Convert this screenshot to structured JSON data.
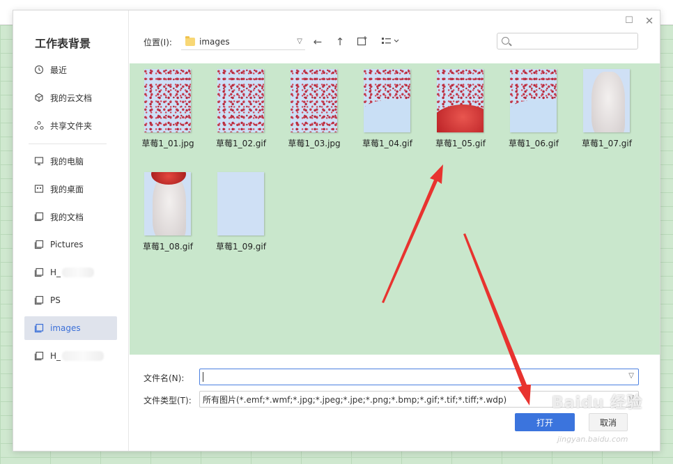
{
  "dialog": {
    "title": "工作表背景"
  },
  "sidebar": {
    "items": [
      {
        "label": "最近",
        "icon": "clock-icon"
      },
      {
        "label": "我的云文档",
        "icon": "cloud-box-icon"
      },
      {
        "label": "共享文件夹",
        "icon": "share-icon"
      },
      {
        "label": "我的电脑",
        "icon": "monitor-icon"
      },
      {
        "label": "我的桌面",
        "icon": "desktop-icon"
      },
      {
        "label": "我的文档",
        "icon": "document-folder-icon"
      },
      {
        "label": "Pictures",
        "icon": "folder-icon"
      },
      {
        "label": "H_",
        "icon": "folder-icon"
      },
      {
        "label": "PS",
        "icon": "folder-icon"
      },
      {
        "label": "images",
        "icon": "folder-icon",
        "active": true
      },
      {
        "label": "H_",
        "icon": "folder-icon"
      }
    ]
  },
  "toolbar": {
    "location_label": "位置(I):",
    "location_value": "images",
    "search_placeholder": ""
  },
  "files": [
    {
      "name": "草莓1_01.jpg"
    },
    {
      "name": "草莓1_02.gif"
    },
    {
      "name": "草莓1_03.jpg"
    },
    {
      "name": "草莓1_04.gif"
    },
    {
      "name": "草莓1_05.gif"
    },
    {
      "name": "草莓1_06.gif"
    },
    {
      "name": "草莓1_07.gif"
    },
    {
      "name": "草莓1_08.gif"
    },
    {
      "name": "草莓1_09.gif"
    }
  ],
  "footer": {
    "filename_label": "文件名(N):",
    "filename_value": "",
    "filetype_label": "文件类型(T):",
    "filetype_value": "所有图片(*.emf;*.wmf;*.jpg;*.jpeg;*.jpe;*.png;*.bmp;*.gif;*.tif;*.tiff;*.wdp)",
    "open_label": "打开",
    "cancel_label": "取消"
  },
  "watermark": {
    "text": "Baidu 经验",
    "url": "jingyan.baidu.com"
  },
  "colors": {
    "accent": "#3b74dd",
    "file_area_bg": "#c9e7cc",
    "arrow": "#e8332f"
  }
}
